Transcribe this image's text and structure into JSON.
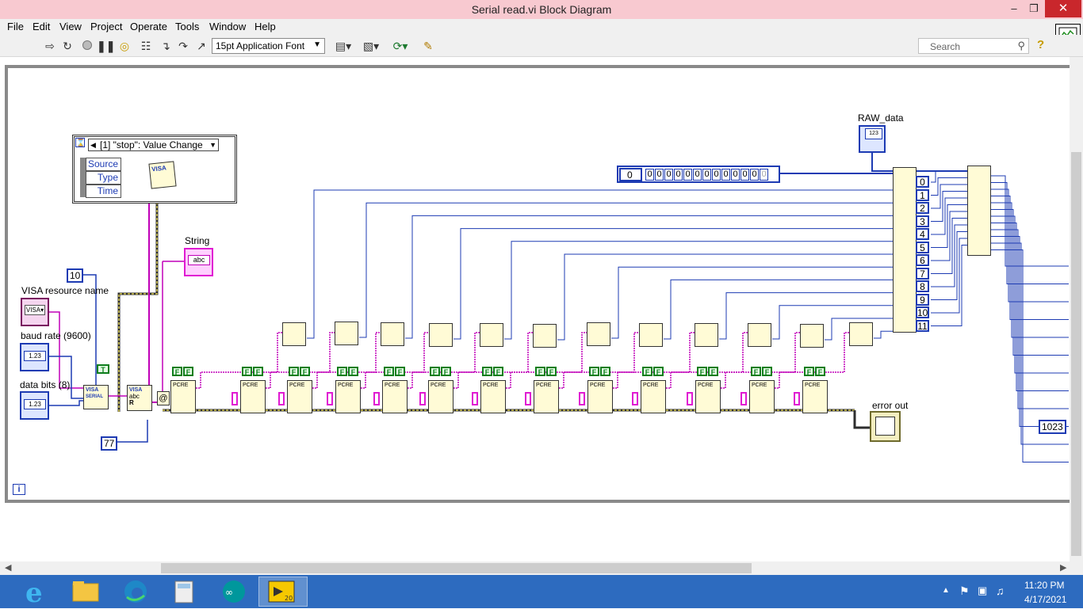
{
  "window": {
    "title": "Serial read.vi Block Diagram",
    "controls": {
      "minimize": "–",
      "restore": "❐",
      "close": "✕"
    }
  },
  "menu": [
    "File",
    "Edit",
    "View",
    "Project",
    "Operate",
    "Tools",
    "Window",
    "Help"
  ],
  "toolbar": {
    "font": "15pt Application Font",
    "search_placeholder": "Search",
    "icons": [
      "run-arrow-icon",
      "run-continuously-icon",
      "abort-icon",
      "pause-icon",
      "highlight-execution-icon",
      "retain-wire-values-icon",
      "step-into-icon",
      "step-over-icon",
      "step-out-icon",
      "align-icon",
      "distribute-icon",
      "reorder-icon",
      "cleanup-icon"
    ]
  },
  "diagram": {
    "labels": {
      "raw_data": "RAW_data",
      "string": "String",
      "visa_resource": "VISA resource name",
      "baud_rate": "baud rate (9600)",
      "data_bits": "data bits (8)",
      "error_out": "error out"
    },
    "constants": {
      "timeout_ms": "10",
      "termchar": "77",
      "array_size": "1023",
      "array_index": "0",
      "array_values": [
        "0",
        "0",
        "0",
        "0",
        "0",
        "0",
        "0",
        "0",
        "0",
        "0",
        "0",
        "0",
        "0"
      ]
    },
    "event_structure": {
      "case": "[1] \"stop\": Value Change",
      "nodes": [
        "Source",
        "Type",
        "Time"
      ]
    },
    "index_array_indices": [
      "0",
      "1",
      "2",
      "3",
      "4",
      "5",
      "6",
      "7",
      "8",
      "9",
      "10",
      "11"
    ],
    "visa_labels": {
      "visa": "VISA",
      "serial": "SERIAL",
      "abc": "abc",
      "r": "R"
    },
    "bool_const": "F",
    "true_const": "T",
    "regex_node_text": "PCRE",
    "info_icon": "i"
  },
  "taskbar": {
    "time": "11:20 PM",
    "date": "4/17/2021",
    "apps": [
      "ie-icon",
      "file-explorer-icon",
      "edge-icon",
      "calculator-icon",
      "arduino-icon",
      "labview-icon"
    ]
  }
}
